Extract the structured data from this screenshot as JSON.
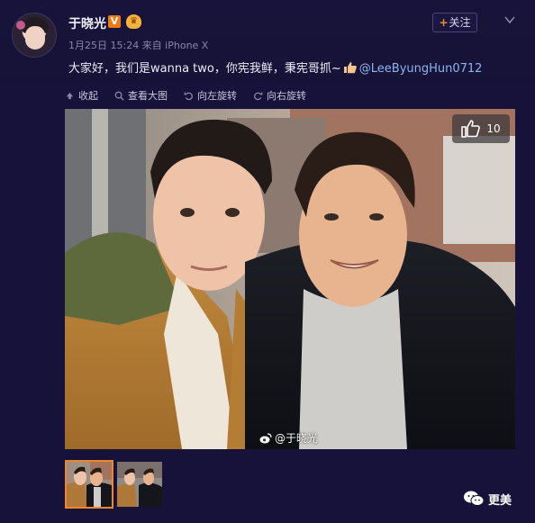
{
  "post": {
    "username": "于晓光",
    "verified_badge": "V",
    "meta": "1月25日 15:24 来自 iPhone X",
    "follow_label": "关注",
    "text_main": "大家好，我们是wanna two，你宪我鲜，秉宪哥抓~",
    "mention": "@LeeByungHun0712"
  },
  "toolbar": {
    "collapse": "收起",
    "view_large": "查看大图",
    "rotate_left": "向左旋转",
    "rotate_right": "向右旋转"
  },
  "photo": {
    "like_count": "10",
    "watermark": "@于晓光"
  },
  "thumbnails": [
    "thumb-1",
    "thumb-2"
  ],
  "brand": {
    "label": "更美"
  },
  "colors": {
    "background": "#16123a",
    "accent_orange": "#f0862a",
    "mention_blue": "#8eb5f0",
    "verified_orange": "#f07a12"
  },
  "icons": [
    "chevron-down-icon",
    "collapse-icon",
    "zoom-icon",
    "rotate-left-icon",
    "rotate-right-icon",
    "thumbs-up-icon",
    "weibo-icon",
    "wechat-icon"
  ]
}
